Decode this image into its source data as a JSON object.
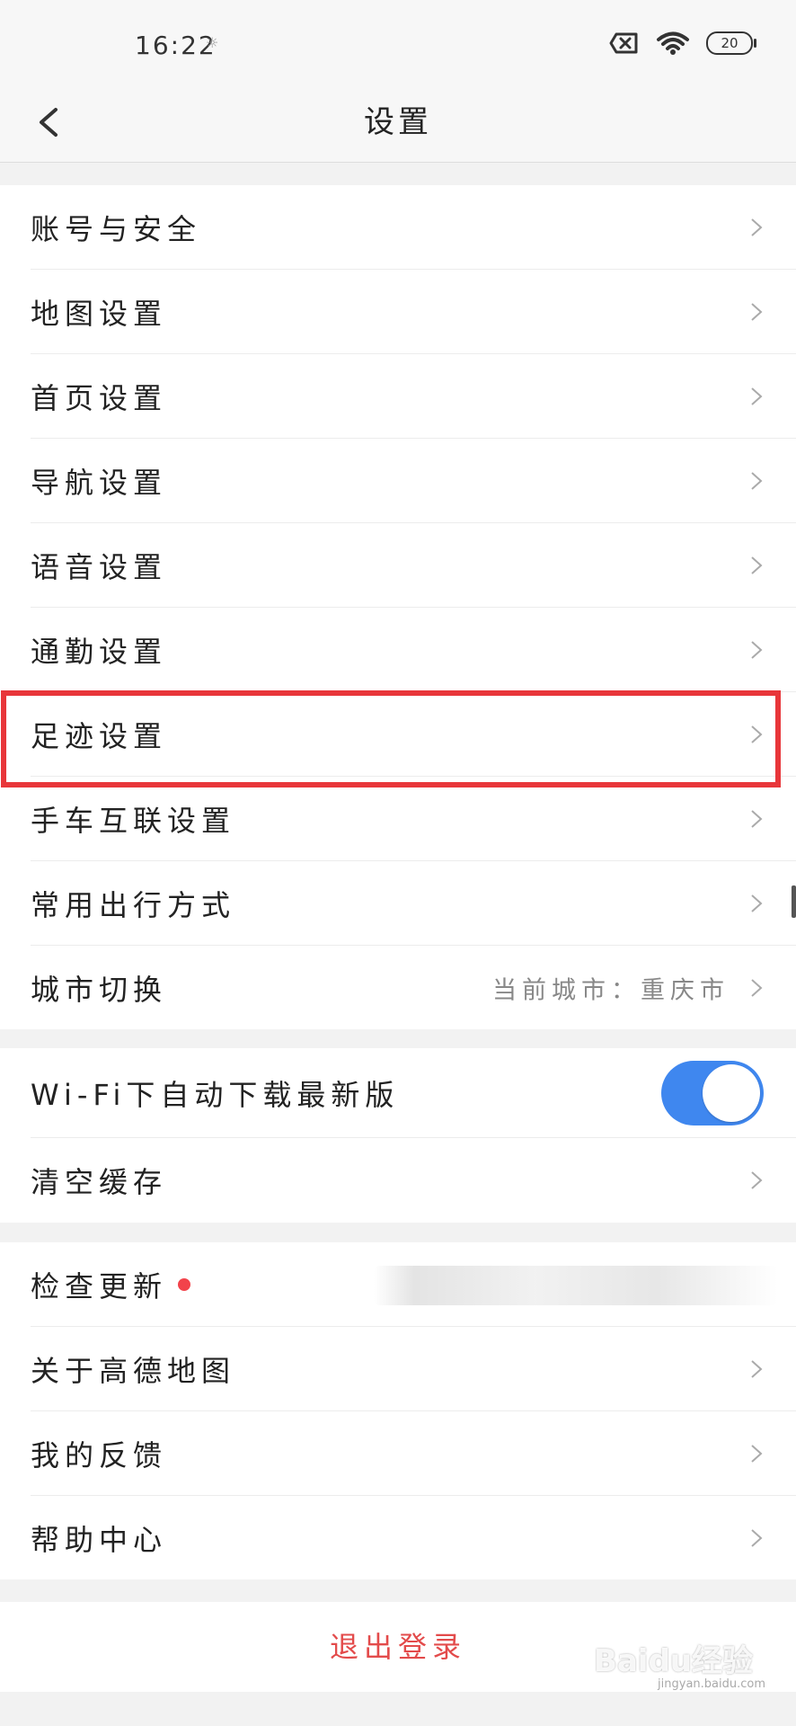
{
  "status_bar": {
    "time": "16:22",
    "dnd_mark": "☼",
    "battery": "20"
  },
  "header": {
    "title": "设置"
  },
  "group1": [
    {
      "label": "账号与安全"
    },
    {
      "label": "地图设置"
    },
    {
      "label": "首页设置"
    },
    {
      "label": "导航设置"
    },
    {
      "label": "语音设置"
    },
    {
      "label": "通勤设置"
    },
    {
      "label": "足迹设置"
    },
    {
      "label": "手车互联设置"
    },
    {
      "label": "常用出行方式"
    },
    {
      "label": "城市切换",
      "value": "当前城市：重庆市"
    }
  ],
  "group2": [
    {
      "label": "Wi-Fi下自动下载最新版",
      "toggle_on": true
    },
    {
      "label": "清空缓存"
    }
  ],
  "group3": [
    {
      "label": "检查更新",
      "badge_color": "#f2434b"
    },
    {
      "label": "关于高德地图"
    },
    {
      "label": "我的反馈"
    },
    {
      "label": "帮助中心"
    }
  ],
  "logout": {
    "label": "退出登录"
  },
  "watermark": {
    "brand": "Baidu经验",
    "url": "jingyan.baidu.com"
  },
  "colors": {
    "accent": "#3f87ef",
    "highlight": "#e8363a",
    "logout": "#e34b4b"
  }
}
